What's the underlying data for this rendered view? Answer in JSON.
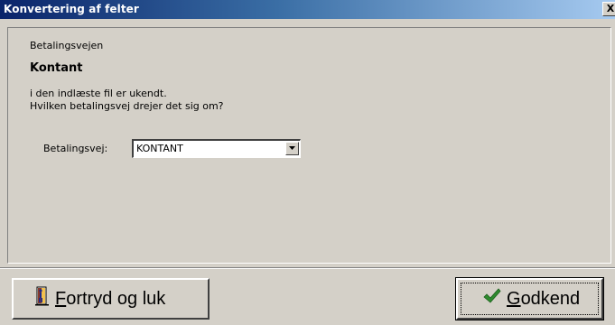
{
  "window": {
    "title": "Konvertering af felter",
    "close_label": "X"
  },
  "content": {
    "subtitle": "Betalingsvejen",
    "heading": "Kontant",
    "description_line1": "i den indlæste fil er ukendt.",
    "description_line2": "Hvilken betalingsvej drejer det sig om?"
  },
  "form": {
    "payment_label": "Betalingsvej:",
    "payment_value": "KONTANT"
  },
  "buttons": {
    "cancel": {
      "mnemonic": "F",
      "rest": "ortryd og luk",
      "icon": "door-exit-icon"
    },
    "ok": {
      "mnemonic": "G",
      "rest": "odkend",
      "icon": "checkmark-icon"
    }
  },
  "colors": {
    "titlebar_start": "#0a246a",
    "titlebar_end": "#a6caf0",
    "dialog_bg": "#d4d0c8",
    "check_green": "#2e8b2e"
  }
}
